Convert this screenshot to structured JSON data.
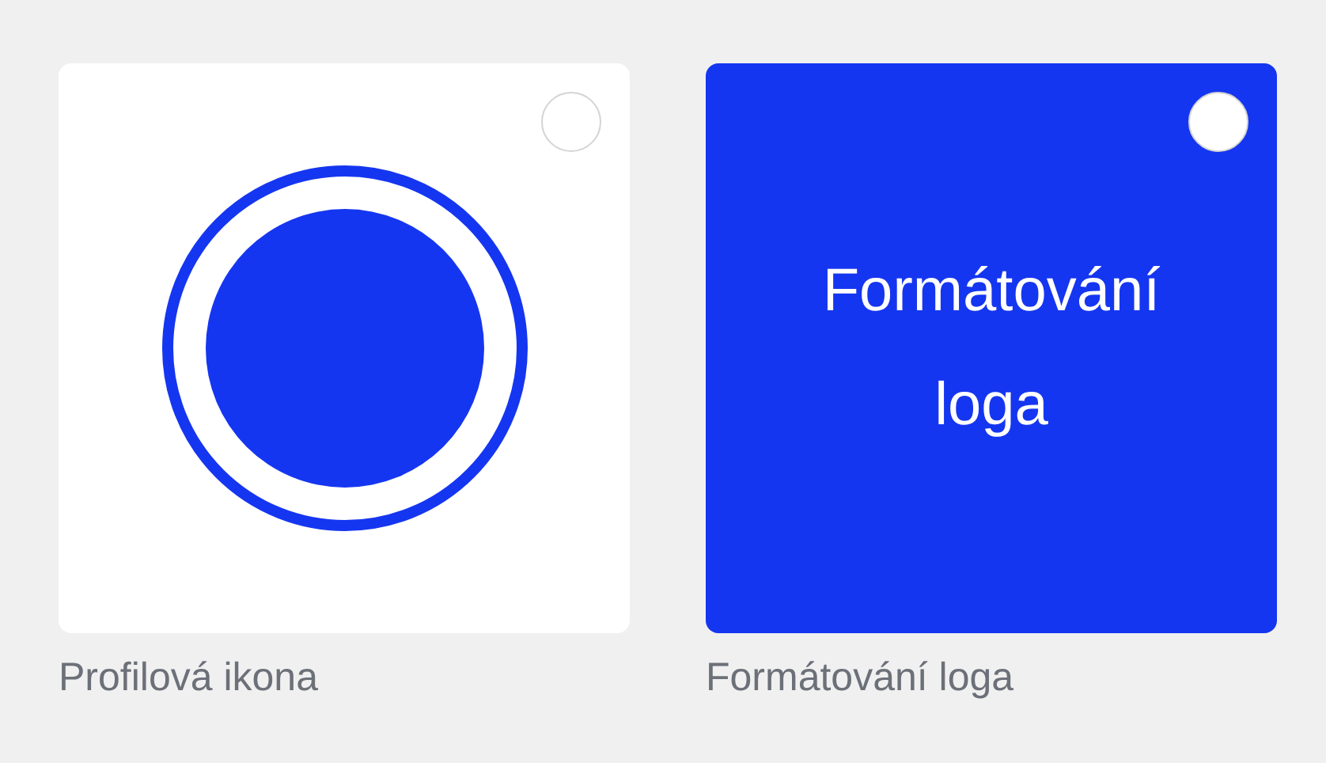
{
  "options": [
    {
      "kind": "icon",
      "label": "Profilová ikona",
      "selected": false
    },
    {
      "kind": "text",
      "tile_text": "Formátování loga",
      "label": "Formátování loga",
      "selected": false
    }
  ]
}
